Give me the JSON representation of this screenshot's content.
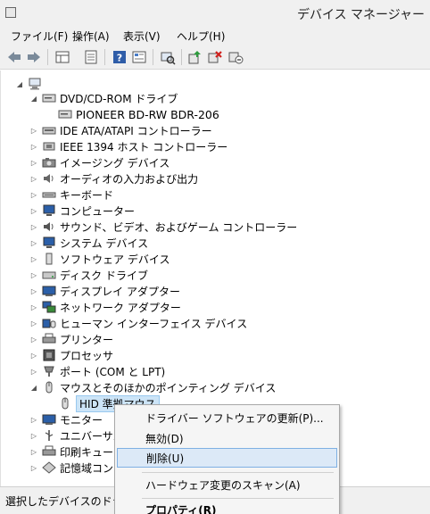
{
  "window": {
    "title": "デバイス マネージャー"
  },
  "menu": [
    {
      "label": "ファイル(F)"
    },
    {
      "label": "操作(A)"
    },
    {
      "label": "表示(V)"
    },
    {
      "label": "ヘルプ(H)"
    }
  ],
  "toolbar": {
    "icons": [
      "back-icon",
      "forward-icon",
      "properties-grid-icon",
      "list-view-icon",
      "help-icon",
      "details-icon",
      "scan-hardware-icon",
      "update-driver-icon",
      "uninstall-icon",
      "disable-icon"
    ]
  },
  "tree": {
    "dvd_category": "DVD/CD-ROM ドライブ",
    "dvd_device": "PIONEER BD-RW   BDR-206",
    "categories": [
      "IDE ATA/ATAPI コントローラー",
      "IEEE 1394 ホスト コントローラー",
      "イメージング デバイス",
      "オーディオの入力および出力",
      "キーボード",
      "コンピューター",
      "サウンド、ビデオ、およびゲーム コントローラー",
      "システム デバイス",
      "ソフトウェア デバイス",
      "ディスク ドライブ",
      "ディスプレイ アダプター",
      "ネットワーク アダプター",
      "ヒューマン インターフェイス デバイス",
      "プリンター",
      "プロセッサ",
      "ポート (COM と LPT)"
    ],
    "mouse_category": "マウスとそのほかのポインティング デバイス",
    "mouse_device": "HID 準拠マウス",
    "after": [
      "モニター",
      "ユニバーサル",
      "印刷キュー",
      "記憶域コント"
    ]
  },
  "context_menu": {
    "update": "ドライバー ソフトウェアの更新(P)...",
    "disable": "無効(D)",
    "uninstall": "削除(U)",
    "scan": "ハードウェア変更のスキャン(A)",
    "properties": "プロパティ(R)"
  },
  "status": {
    "text": "選択したデバイスのドライバ"
  }
}
